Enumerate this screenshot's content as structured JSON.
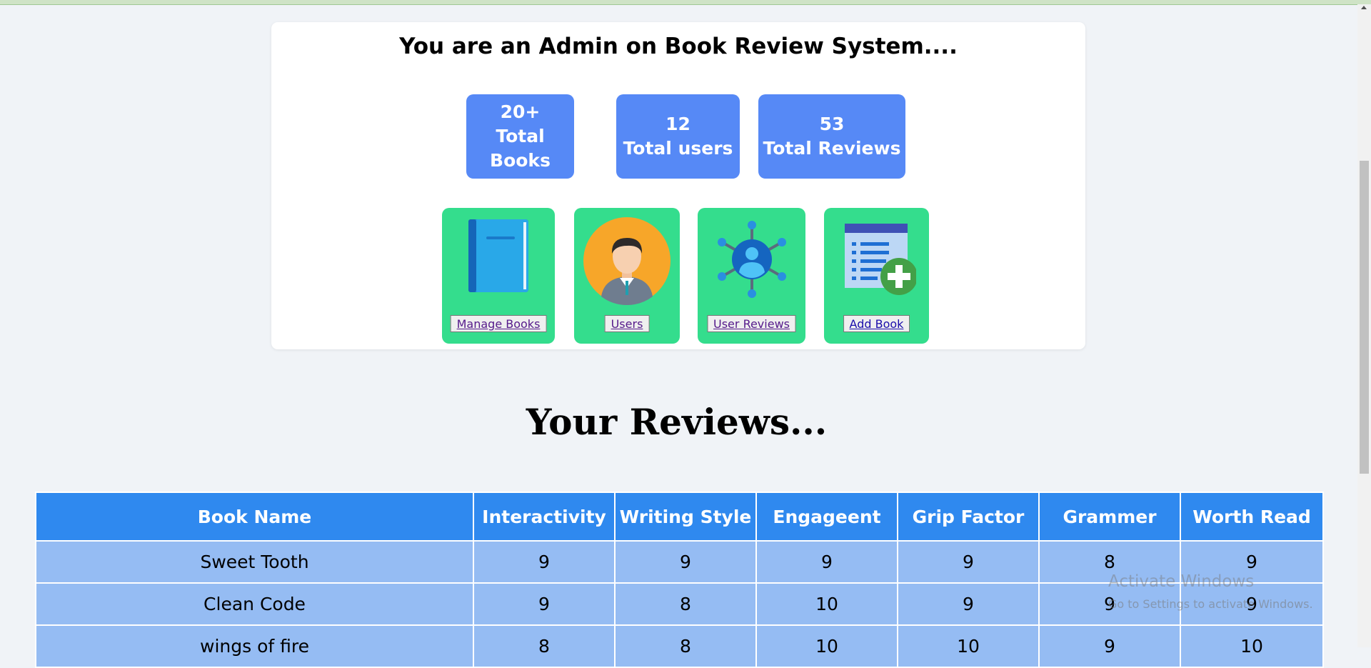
{
  "admin": {
    "title": "You are an Admin on Book Review System....",
    "stats": [
      {
        "value": "20+",
        "label": "Total Books"
      },
      {
        "value": "12",
        "label": "Total users"
      },
      {
        "value": "53",
        "label": "Total Reviews"
      }
    ],
    "tiles": [
      {
        "icon": "book-icon",
        "label": "Manage Books"
      },
      {
        "icon": "user-avatar-icon",
        "label": "Users"
      },
      {
        "icon": "user-network-icon",
        "label": "User Reviews"
      },
      {
        "icon": "add-document-icon",
        "label": "Add Book"
      }
    ]
  },
  "reviews": {
    "heading": "Your Reviews...",
    "columns": [
      "Book Name",
      "Interactivity",
      "Writing Style",
      "Engageent",
      "Grip Factor",
      "Grammer",
      "Worth Read"
    ],
    "rows": [
      [
        "Sweet Tooth",
        "9",
        "9",
        "9",
        "9",
        "8",
        "9"
      ],
      [
        "Clean Code",
        "9",
        "8",
        "10",
        "9",
        "9",
        "9"
      ],
      [
        "wings of fire",
        "8",
        "8",
        "10",
        "10",
        "9",
        "10"
      ]
    ]
  },
  "watermark": {
    "line1": "Activate Windows",
    "line2": "Go to Settings to activate Windows."
  },
  "colors": {
    "stat_bg": "#5689f6",
    "tile_bg": "#34dd8d",
    "table_header": "#2f89ef",
    "table_row": "#95bcf3"
  }
}
